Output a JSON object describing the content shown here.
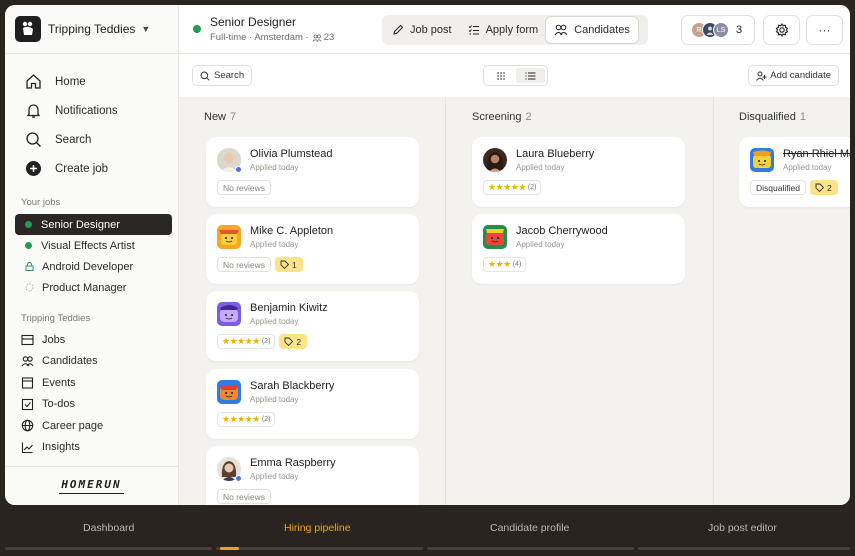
{
  "workspace": {
    "name": "Tripping Teddies"
  },
  "nav": {
    "home": "Home",
    "notifications": "Notifications",
    "search": "Search",
    "create_job": "Create job"
  },
  "your_jobs": {
    "title": "Your jobs",
    "items": [
      {
        "label": "Senior Designer",
        "status_color": "#1f9d55"
      },
      {
        "label": "Visual Effects Artist",
        "status_color": "#1f9d55"
      },
      {
        "label": "Android Developer",
        "status_color": "#1f9d55"
      },
      {
        "label": "Product Manager",
        "status_color": "#b8b5ad"
      }
    ]
  },
  "workspace_menu": {
    "title": "Tripping Teddies",
    "items": [
      "Jobs",
      "Candidates",
      "Events",
      "To-dos",
      "Career page",
      "Insights"
    ]
  },
  "brand": "HOMERUN",
  "job_header": {
    "title": "Senior Designer",
    "subtitle": "Full-time · Amsterdam ·",
    "candidate_count": "23"
  },
  "views": {
    "job_post": "Job post",
    "apply_form": "Apply form",
    "candidates": "Candidates"
  },
  "team": {
    "initials_1": "R",
    "initials_3": "LS",
    "count": "3"
  },
  "toolbar": {
    "search": "Search",
    "add_candidate": "Add candidate"
  },
  "columns": [
    {
      "title": "New",
      "count": "7",
      "cards": [
        {
          "name": "Olivia Plumstead",
          "sub": "Applied today",
          "reviews": "No reviews"
        },
        {
          "name": "Mike C. Appleton",
          "sub": "Applied today",
          "reviews": "No reviews",
          "tag": "1"
        },
        {
          "name": "Benjamin Kiwitz",
          "sub": "Applied today",
          "stars": "★★★★★",
          "star_count": "(2)",
          "tag": "2"
        },
        {
          "name": "Sarah Blackberry",
          "sub": "Applied today",
          "stars": "★★★★★",
          "star_count": "(2)"
        },
        {
          "name": "Emma Raspberry",
          "sub": "Applied today",
          "reviews": "No reviews"
        }
      ]
    },
    {
      "title": "Screening",
      "count": "2",
      "cards": [
        {
          "name": "Laura Blueberry",
          "sub": "Applied today",
          "stars": "★★★★★",
          "star_count": "(2)"
        },
        {
          "name": "Jacob Cherrywood",
          "sub": "Applied today",
          "stars": "★★★",
          "star_count": "(4)"
        }
      ]
    },
    {
      "title": "Disqualified",
      "count": "1",
      "cards": [
        {
          "name": "Ryan Rhiel Ma",
          "sub": "Applied today",
          "status": "Disqualified",
          "tag": "2"
        }
      ]
    }
  ],
  "bottom_tabs": [
    "Dashboard",
    "Hiring pipeline",
    "Candidate profile",
    "Job post editor"
  ],
  "colors": {
    "accent": "#f1a21b",
    "tag_yellow": "#fbe38a",
    "star": "#e9b400",
    "dark": "#2a2420"
  }
}
